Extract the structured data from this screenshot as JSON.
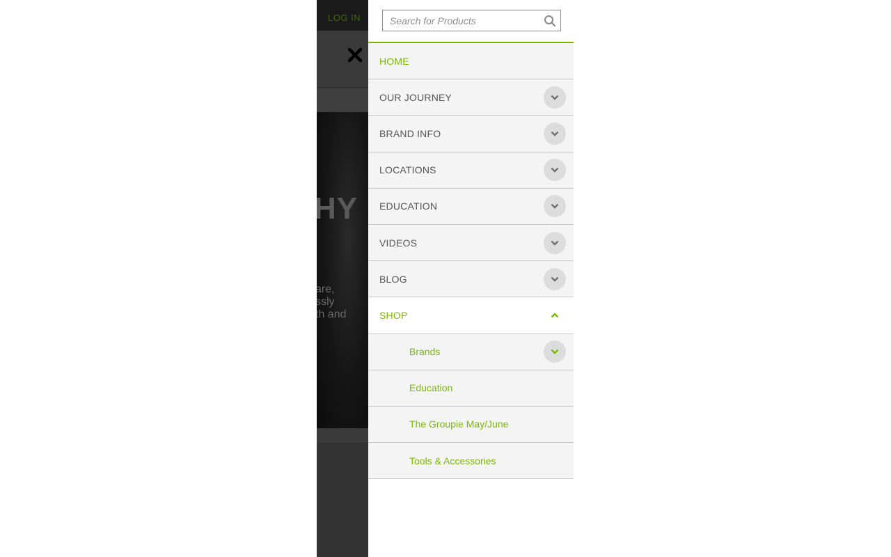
{
  "background_page": {
    "login_label": "LOG IN",
    "hero_title_fragment": "HY",
    "hero_text_lines": [
      "are,",
      "ssly",
      "th and"
    ]
  },
  "search": {
    "placeholder": "Search for Products"
  },
  "menu": {
    "items": [
      {
        "label": "HOME"
      },
      {
        "label": "OUR JOURNEY"
      },
      {
        "label": "BRAND INFO"
      },
      {
        "label": "LOCATIONS"
      },
      {
        "label": "EDUCATION"
      },
      {
        "label": "VIDEOS"
      },
      {
        "label": "BLOG"
      },
      {
        "label": "SHOP"
      }
    ],
    "shop_subitems": [
      {
        "label": "Brands"
      },
      {
        "label": "Education"
      },
      {
        "label": "The Groupie May/June"
      },
      {
        "label": "Tools & Accessories"
      }
    ]
  },
  "colors": {
    "accent": "#7ab800",
    "overlay": "#333333",
    "menu_bg": "#f4f4f4",
    "divider": "#c8c8c8"
  },
  "icons": {
    "search": "search-icon",
    "close": "close-icon",
    "expand": "chevron-down-icon",
    "collapse": "chevron-up-icon"
  }
}
